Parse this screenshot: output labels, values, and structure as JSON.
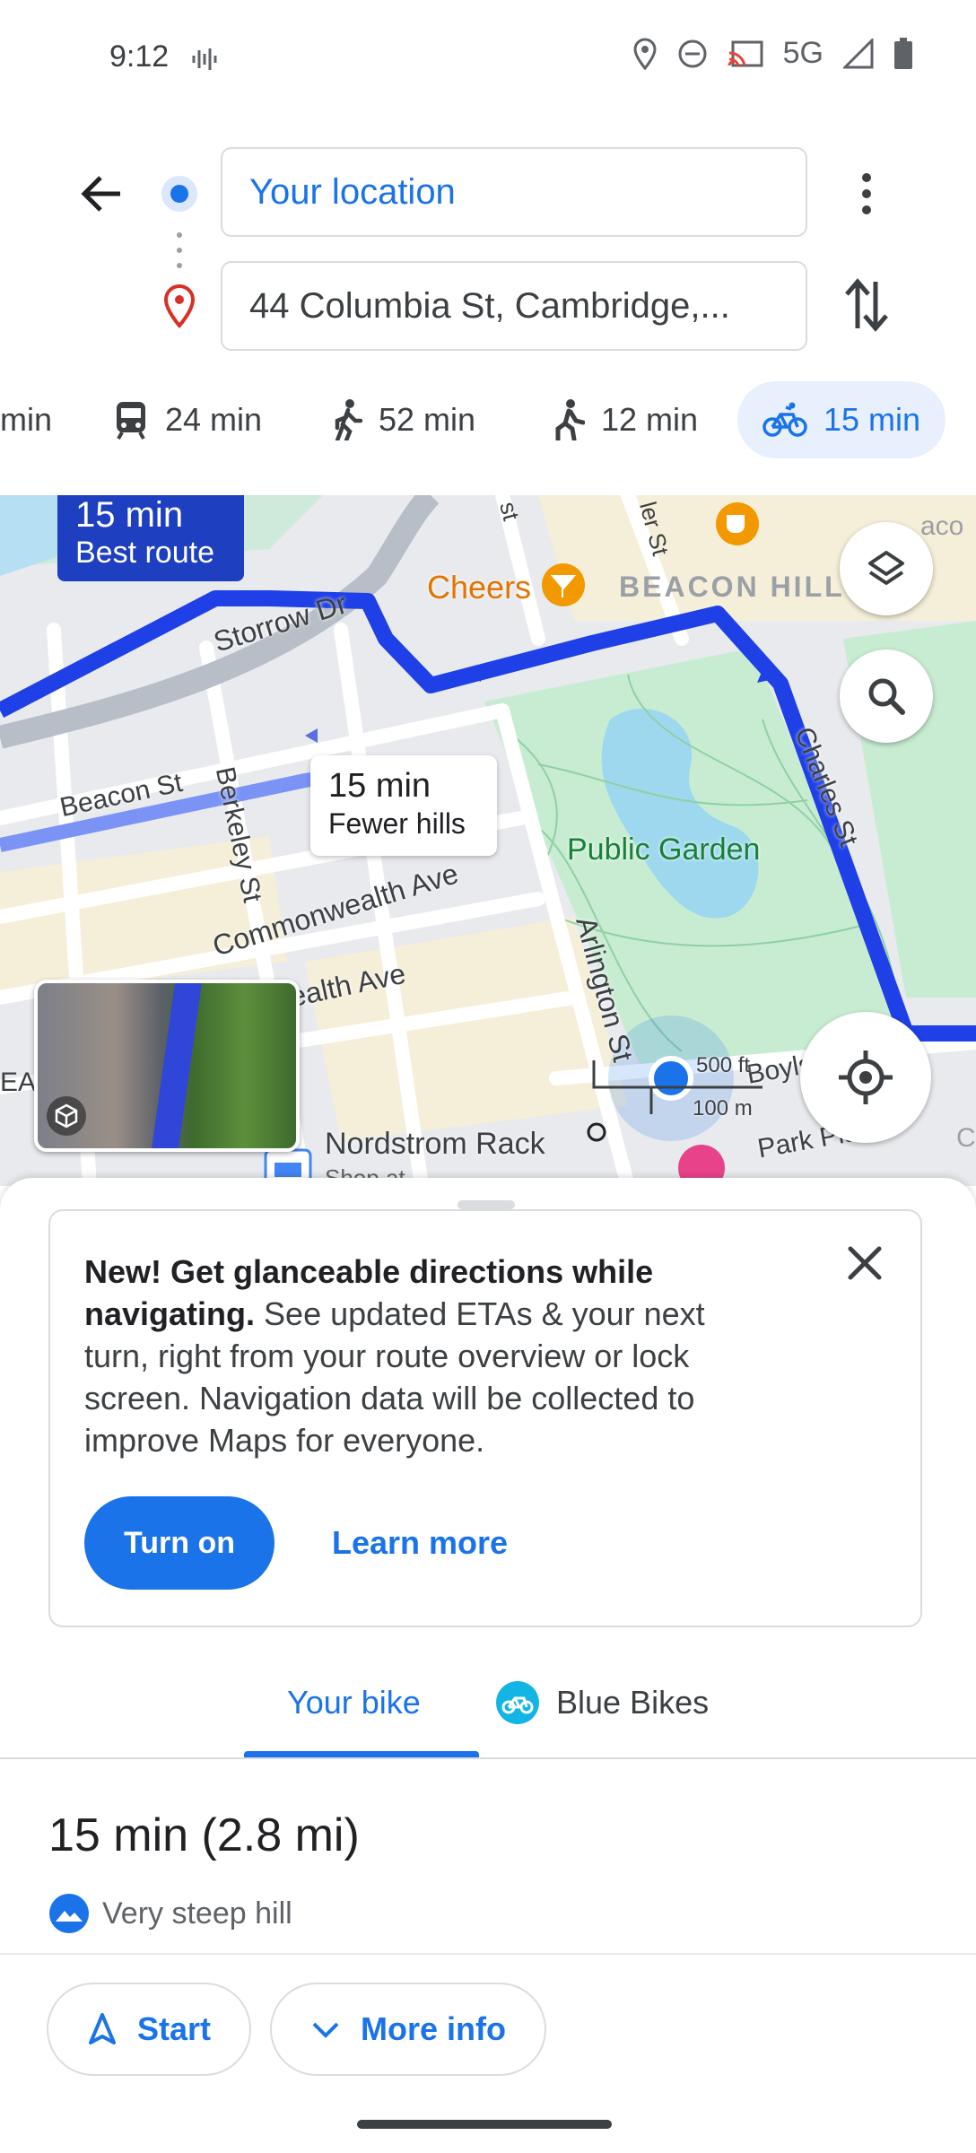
{
  "status_bar": {
    "time": "9:12",
    "network": "5G"
  },
  "header": {
    "origin": "Your location",
    "destination": "44 Columbia St, Cambridge,..."
  },
  "travel_modes": [
    {
      "icon": "car-icon",
      "label": "min"
    },
    {
      "icon": "transit-icon",
      "label": "24 min"
    },
    {
      "icon": "walk-icon",
      "label": "52 min"
    },
    {
      "icon": "rideshare-icon",
      "label": "12 min"
    },
    {
      "icon": "bike-icon",
      "label": "15 min",
      "selected": true
    }
  ],
  "map": {
    "best_route": {
      "time": "15 min",
      "subtitle": "Best route"
    },
    "alt_route": {
      "time": "15 min",
      "subtitle": "Fewer hills"
    },
    "streets": [
      "Storrow Dr",
      "Beacon St",
      "Berkeley St",
      "Commonwealth Ave",
      "ealth Ave",
      "Arlington St",
      "Charles St",
      "Boylston",
      "Park Plaza",
      "ler St",
      "st"
    ],
    "places": [
      "Cheers",
      "BEACON HILL",
      "Public Garden",
      "Nordstrom Rack",
      "Shop at"
    ],
    "scale": {
      "imperial": "500 ft",
      "metric": "100 m"
    },
    "edge_labels": [
      "aco",
      "EA",
      "C"
    ]
  },
  "promo": {
    "bold": "New! Get glanceable directions while navigating.",
    "body": " See updated ETAs & your next turn, right from your route overview or lock screen. Navigation data will be collected to improve Maps for everyone.",
    "primary_button": "Turn on",
    "secondary_button": "Learn more"
  },
  "tabs": [
    {
      "label": "Your bike",
      "selected": true
    },
    {
      "label": "Blue Bikes",
      "selected": false
    }
  ],
  "summary": {
    "duration": "15 min",
    "distance": "(2.8 mi)",
    "warning": "Very steep hill"
  },
  "actions": {
    "start": "Start",
    "more_info": "More info"
  },
  "colors": {
    "accent": "#1a73e8",
    "route": "#1e40e6",
    "route_alt": "#7b93f5",
    "park": "#c8ecd2",
    "water": "#9ed8ee"
  }
}
